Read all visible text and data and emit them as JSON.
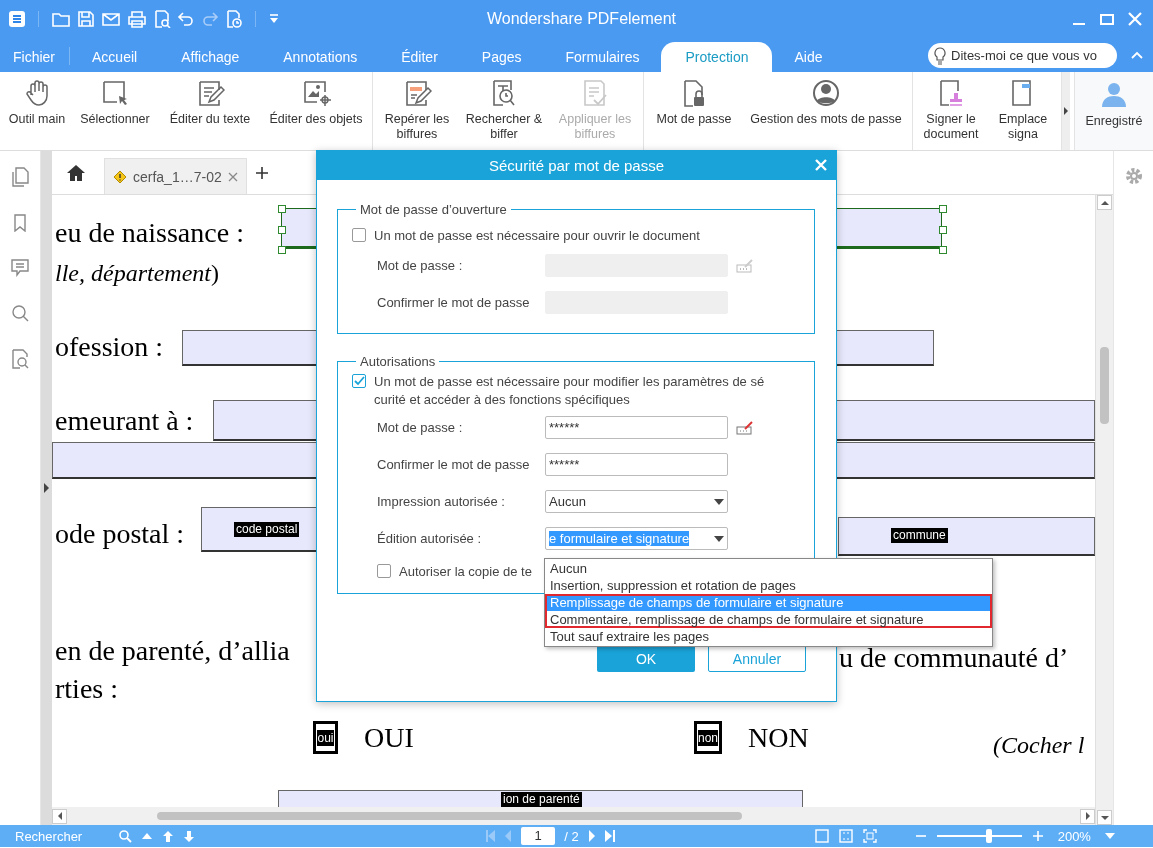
{
  "window": {
    "title": "Wondershare PDFelement"
  },
  "menu": [
    {
      "label": "Fichier",
      "selected": false
    },
    {
      "label": "Accueil",
      "selected": false
    },
    {
      "label": "Affichage",
      "selected": false
    },
    {
      "label": "Annotations",
      "selected": false
    },
    {
      "label": "Éditer",
      "selected": false
    },
    {
      "label": "Pages",
      "selected": false
    },
    {
      "label": "Formulaires",
      "selected": false
    },
    {
      "label": "Protection",
      "selected": true
    },
    {
      "label": "Aide",
      "selected": false
    }
  ],
  "tell_me": {
    "placeholder": "Dites-moi ce que vous vo"
  },
  "ribbon": {
    "groups": [
      {
        "items": [
          {
            "label": "Outil main",
            "disabled": false
          },
          {
            "label": "Sélectionner",
            "disabled": false
          },
          {
            "label": "Éditer du texte",
            "disabled": false
          },
          {
            "label": "Éditer des objets",
            "disabled": false
          }
        ]
      },
      {
        "items": [
          {
            "label": "Repérer les biffures",
            "disabled": false
          },
          {
            "label": "Rechercher & biffer",
            "disabled": false
          },
          {
            "label": "Appliquer les biffures",
            "disabled": true
          }
        ]
      },
      {
        "items": [
          {
            "label": "Mot de passe",
            "disabled": false
          },
          {
            "label": "Gestion des mots de passe",
            "disabled": false
          }
        ]
      },
      {
        "items": [
          {
            "label": "Signer le document",
            "disabled": false
          },
          {
            "label": "Emplace signa",
            "disabled": false
          }
        ]
      }
    ],
    "account": "Enregistré"
  },
  "document_tab": {
    "label": "cerfa_1…7-02"
  },
  "document": [
    {
      "kind": "text",
      "text": "eu de naissance :"
    },
    {
      "kind": "field",
      "selected": true
    },
    {
      "kind": "text",
      "text": "*lle, département*)"
    },
    {
      "kind": "text",
      "text": "ofession :"
    },
    {
      "kind": "field",
      "selected": false
    },
    {
      "kind": "text",
      "text": "emeurant à :"
    },
    {
      "kind": "field",
      "selected": false
    },
    {
      "kind": "field",
      "selected": false
    },
    {
      "kind": "text",
      "text": "ode postal :"
    },
    {
      "kind": "field",
      "selected": false,
      "label": "code postal"
    },
    {
      "kind": "field",
      "selected": false,
      "label": "commune"
    },
    {
      "kind": "text",
      "text": "en de parenté, d’allia"
    },
    {
      "kind": "text",
      "text": "u de communauté d’"
    },
    {
      "kind": "text",
      "text": "rties :"
    },
    {
      "kind": "checkbox",
      "label": "oui"
    },
    {
      "kind": "text",
      "text": "OUI"
    },
    {
      "kind": "checkbox",
      "label": "non"
    },
    {
      "kind": "text",
      "text": "NON"
    },
    {
      "kind": "italic",
      "text": "(Cocher l"
    },
    {
      "kind": "field",
      "selected": false,
      "label": "ion de parenté"
    }
  ],
  "dialog": {
    "title": "Sécurité par mot de passe",
    "groups": [
      {
        "title": "Mot de passe d’ouverture",
        "checkbox": {
          "label": "Un mot de passe est nécessaire pour ouvrir le document",
          "checked": false
        },
        "fields": [
          {
            "kind": "password",
            "label": "Mot de passe :",
            "disabled": true
          },
          {
            "kind": "password",
            "label": "Confirmer le mot de passe",
            "disabled": true
          }
        ]
      },
      {
        "title": "Autorisations",
        "checkbox": {
          "label": "Un mot de passe est nécessaire pour modifier les paramètres de sécurité et accéder à des fonctions spécifiques",
          "checked": true
        },
        "fields": [
          {
            "kind": "password",
            "label": "Mot de passe :",
            "value": "******",
            "disabled": false
          },
          {
            "kind": "password",
            "label": "Confirmer le mot de passe",
            "value": "******",
            "disabled": false
          },
          {
            "kind": "select",
            "label": "Impression autorisée :",
            "value": "Aucun",
            "focused": false
          },
          {
            "kind": "select",
            "label": "Édition autorisée :",
            "value": "e formulaire et signature",
            "focused": true
          }
        ],
        "extra_checkbox": {
          "label": "Autoriser la copie de te",
          "checked": false
        }
      }
    ],
    "buttons": [
      {
        "label": "OK",
        "kind": "primary"
      },
      {
        "label": "Annuler",
        "kind": "secondary"
      }
    ]
  },
  "dropdown": {
    "options": [
      {
        "label": "Aucun",
        "selected": false,
        "highlighted": false
      },
      {
        "label": "Insertion, suppression et rotation de pages",
        "selected": false,
        "highlighted": false
      },
      {
        "label": "Remplissage de champs de formulaire et signature",
        "selected": true,
        "highlighted": true
      },
      {
        "label": "Commentaire, remplissage de champs de formulaire et signature",
        "selected": false,
        "highlighted": true
      },
      {
        "label": "Tout sauf extraire les pages",
        "selected": false,
        "highlighted": false
      }
    ]
  },
  "status_bar": {
    "search_label": "Rechercher",
    "page": "1",
    "page_total": "/ 2",
    "level": 0.62,
    "zoom": "200%"
  }
}
